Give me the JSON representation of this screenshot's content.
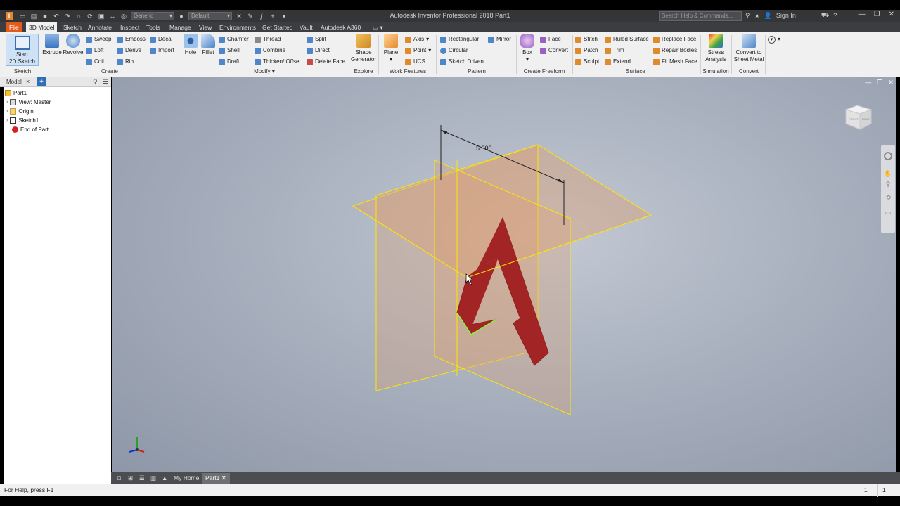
{
  "window": {
    "title": "Autodesk Inventor Professional 2018   Part1",
    "search_placeholder": "Search Help & Commands...",
    "sign_in": "Sign In"
  },
  "qat": {
    "appearance_combo": "Generic",
    "material_combo": "Default"
  },
  "tabs": [
    "File",
    "3D Model",
    "Sketch",
    "Annotate",
    "Inspect",
    "Tools",
    "Manage",
    "View",
    "Environments",
    "Get Started",
    "Vault",
    "Autodesk A360"
  ],
  "ribbon": {
    "sketch": {
      "start_sketch_line1": "Start",
      "start_sketch_line2": "2D Sketch",
      "label": "Sketch"
    },
    "create": {
      "extrude": "Extrude",
      "revolve": "Revolve",
      "sweep": "Sweep",
      "loft": "Loft",
      "coil": "Coil",
      "emboss": "Emboss",
      "derive": "Derive",
      "rib": "Rib",
      "decal": "Decal",
      "import": "Import",
      "label": "Create"
    },
    "modify": {
      "hole": "Hole",
      "fillet": "Fillet",
      "chamfer": "Chamfer",
      "shell": "Shell",
      "draft": "Draft",
      "thread": "Thread",
      "combine": "Combine",
      "thicken": "Thicken/ Offset",
      "split": "Split",
      "direct": "Direct",
      "delete_face": "Delete Face",
      "label": "Modify"
    },
    "explore": {
      "shape_generator_line1": "Shape",
      "shape_generator_line2": "Generator",
      "label": "Explore"
    },
    "work_features": {
      "plane": "Plane",
      "axis": "Axis",
      "point": "Point",
      "ucs": "UCS",
      "label": "Work Features"
    },
    "pattern": {
      "rectangular": "Rectangular",
      "circular": "Circular",
      "sketch_driven": "Sketch Driven",
      "mirror": "Mirror",
      "label": "Pattern"
    },
    "freeform": {
      "box": "Box",
      "face": "Face",
      "convert": "Convert",
      "label": "Create Freeform"
    },
    "surface": {
      "stitch": "Stitch",
      "patch": "Patch",
      "sculpt": "Sculpt",
      "ruled_surface": "Ruled Surface",
      "trim": "Trim",
      "extend": "Extend",
      "replace_face": "Replace Face",
      "repair_bodies": "Repair Bodies",
      "fit_mesh_face": "Fit Mesh Face",
      "label": "Surface"
    },
    "simulation": {
      "stress_line1": "Stress",
      "stress_line2": "Analysis",
      "label": "Simulation"
    },
    "convert": {
      "sheet_metal_line1": "Convert to",
      "sheet_metal_line2": "Sheet Metal",
      "label": "Convert"
    }
  },
  "browser": {
    "tab": "Model",
    "items": [
      {
        "label": "Part1",
        "icon": "part-icon"
      },
      {
        "label": "View: Master",
        "icon": "view-icon"
      },
      {
        "label": "Origin",
        "icon": "folder-icon"
      },
      {
        "label": "Sketch1",
        "icon": "sketch-icon"
      },
      {
        "label": "End of Part",
        "icon": "end-of-part-icon"
      }
    ]
  },
  "viewport": {
    "dimension": "5.000",
    "viewcube_front": "FRONT",
    "viewcube_right": "RIGHT"
  },
  "doc_tabs": {
    "home": "My Home",
    "part": "Part1"
  },
  "status": {
    "help": "For Help, press F1",
    "count1": "1",
    "count2": "1"
  },
  "colors": {
    "accent": "#e35a1c",
    "sketch_fill": "#a32424",
    "plane_edge": "#ffe600",
    "plane_fill": "#d9a078"
  }
}
